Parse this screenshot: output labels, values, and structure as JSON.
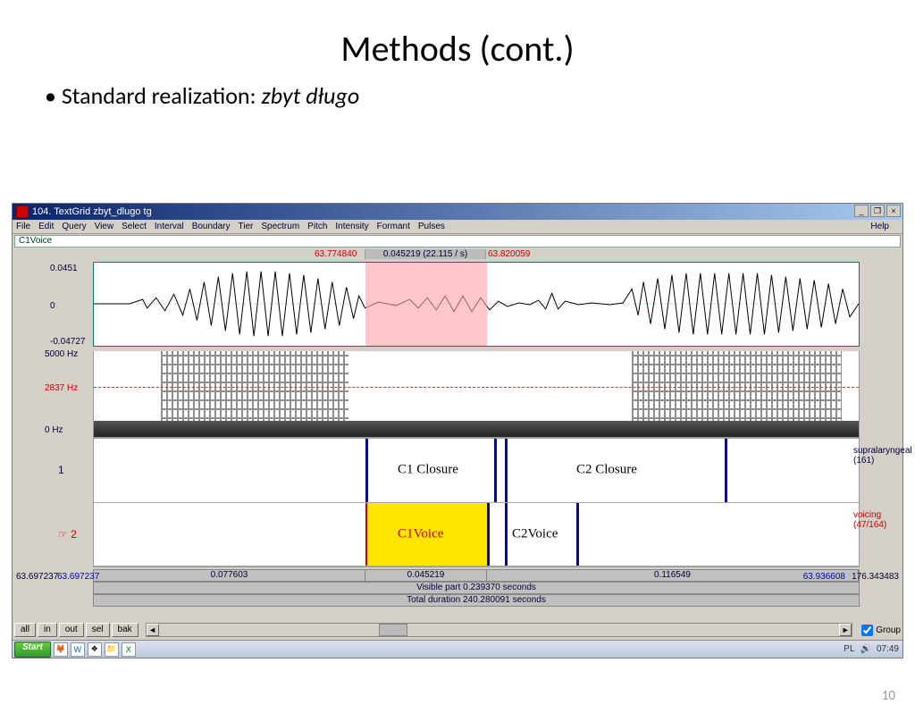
{
  "slide": {
    "title": "Methods (cont.)",
    "bullet_prefix": "Standard realization: ",
    "bullet_italic": "zbyt długo",
    "number": "10"
  },
  "window": {
    "title": "104. TextGrid zbyt_dlugo tg",
    "menus": [
      "File",
      "Edit",
      "Query",
      "View",
      "Select",
      "Interval",
      "Boundary",
      "Tier",
      "Spectrum",
      "Pitch",
      "Intensity",
      "Formant",
      "Pulses"
    ],
    "help": "Help",
    "info_line": "C1Voice",
    "top_time_left": "63.774840",
    "top_time_mid": "0.045219 (22.115 / s)",
    "top_time_right": "63.820059",
    "wave_y_top": "0.0451",
    "wave_y_mid": "0",
    "wave_y_bot": "-0.04727",
    "spec_top": "5000 Hz",
    "spec_mid": "2837 Hz",
    "spec_bot": "0 Hz",
    "tier1_num": "1",
    "tier2_num": "☞ 2",
    "tier1_name": "supralaryngeal (161)",
    "tier2_name": "voicing (47/164)",
    "c1closure": "C1 Closure",
    "c2closure": "C2 Closure",
    "c1voice": "C1Voice",
    "c2voice": "C2Voice",
    "seg1": "0.077603",
    "seg2": "0.045219",
    "seg3": "0.116549",
    "visible": "Visible part 0.239370 seconds",
    "total": "Total duration 240.280091 seconds",
    "t_outer_left": "63.697237",
    "t_inner_left": "63.697237",
    "t_inner_right": "63.936608",
    "t_outer_right": "176.343483",
    "buttons": [
      "all",
      "in",
      "out",
      "sel",
      "bak"
    ],
    "group": "Group"
  },
  "taskbar": {
    "start": "Start",
    "lang": "PL",
    "clock": "07:49"
  }
}
